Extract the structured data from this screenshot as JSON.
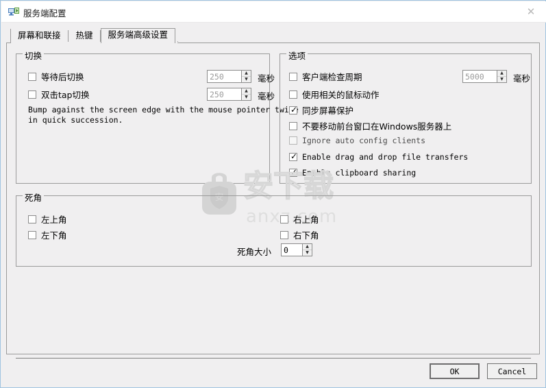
{
  "window": {
    "title": "服务端配置",
    "icon": "app-icon",
    "close_label": "✕"
  },
  "tabs": [
    {
      "label": "屏幕和联接",
      "active": false
    },
    {
      "label": "热键",
      "active": false
    },
    {
      "label": "服务端高级设置",
      "active": true
    }
  ],
  "groups": {
    "switch": {
      "title": "切换",
      "items": [
        {
          "label": "等待后切换",
          "checked": false,
          "spin_value": "250",
          "unit": "毫秒",
          "spin_enabled": false
        },
        {
          "label": "双击tap切换",
          "checked": false,
          "spin_value": "250",
          "unit": "毫秒",
          "spin_enabled": false
        }
      ],
      "hint": "Bump against the screen edge with the mouse pointer twice\nin quick succession."
    },
    "options": {
      "title": "选项",
      "items": [
        {
          "label": "客户端检查周期",
          "checked": false,
          "mono": false,
          "spin_value": "5000",
          "unit": "毫秒",
          "spin_enabled": false
        },
        {
          "label": "使用相关的鼠标动作",
          "checked": false,
          "mono": false
        },
        {
          "label": "同步屏幕保护",
          "checked": true,
          "mono": false
        },
        {
          "label": "不要移动前台窗口在Windows服务器上",
          "checked": false,
          "mono": false
        },
        {
          "label": "Ignore auto config clients",
          "checked": false,
          "mono": true,
          "disabled": true
        },
        {
          "label": "Enable drag and drop file transfers",
          "checked": true,
          "mono": true
        },
        {
          "label": "Enable clipboard sharing",
          "checked": true,
          "mono": true
        }
      ]
    },
    "deadcorner": {
      "title": "死角",
      "left_items": [
        {
          "label": "左上角",
          "checked": false
        },
        {
          "label": "左下角",
          "checked": false
        }
      ],
      "right_items": [
        {
          "label": "右上角",
          "checked": false
        },
        {
          "label": "右下角",
          "checked": false
        }
      ],
      "size_label": "死角大小",
      "size_value": "0"
    }
  },
  "footer": {
    "ok_label": "OK",
    "cancel_label": "Cancel"
  },
  "watermark": {
    "text": "安下载",
    "sub": "anxz.com"
  },
  "colors": {
    "window_border": "#9fc4e0",
    "dialog_bg": "#f0eff0",
    "group_border": "#9a9a9a",
    "titlebar_bg": "#ffffff"
  }
}
